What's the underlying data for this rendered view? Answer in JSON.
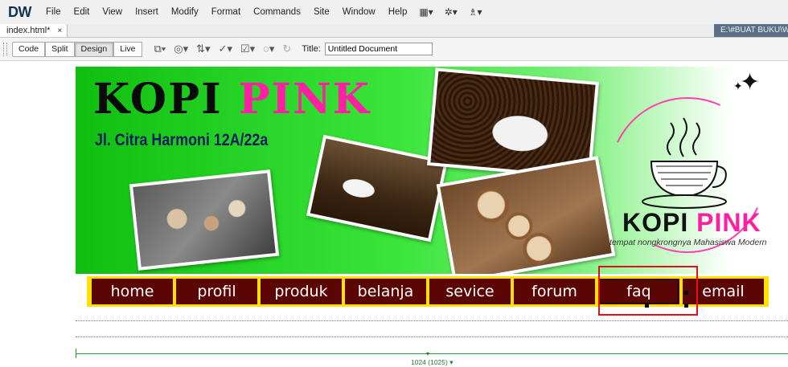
{
  "app": {
    "logo": "DW",
    "menu": [
      "File",
      "Edit",
      "View",
      "Insert",
      "Modify",
      "Format",
      "Commands",
      "Site",
      "Window",
      "Help"
    ],
    "menu_icons": [
      "layout-icon",
      "gear-icon",
      "site-icon"
    ]
  },
  "tabs": {
    "document": "index.html*",
    "close": "×",
    "path": "E:\\#BUAT BUKU\\WE"
  },
  "toolbar": {
    "views": [
      "Code",
      "Split",
      "Design",
      "Live"
    ],
    "active_view": "Design",
    "title_label": "Title:",
    "title_value": "Untitled Document"
  },
  "banner": {
    "title_part1": "KOPI",
    "title_part2": "PINK",
    "address": "Jl. Citra Harmoni 12A/22a",
    "brand_part1": "KOPI",
    "brand_part2": "PINK",
    "tagline": "tempat nongkrongnya Mahasiswa Modern"
  },
  "nav": {
    "items": [
      "home",
      "profil",
      "produk",
      "belanja",
      "sevice",
      "forum",
      "faq",
      "email"
    ],
    "selected": "faq"
  },
  "colors": {
    "nav_bg": "#5c0505",
    "nav_border": "#ffe000",
    "banner_green": "#22d322",
    "brand_pink": "#ff1fa2",
    "selection_red": "#e0101a",
    "ruler_green": "#2aa02a"
  },
  "ruler": {
    "label": "1024 (1025) ▾"
  }
}
